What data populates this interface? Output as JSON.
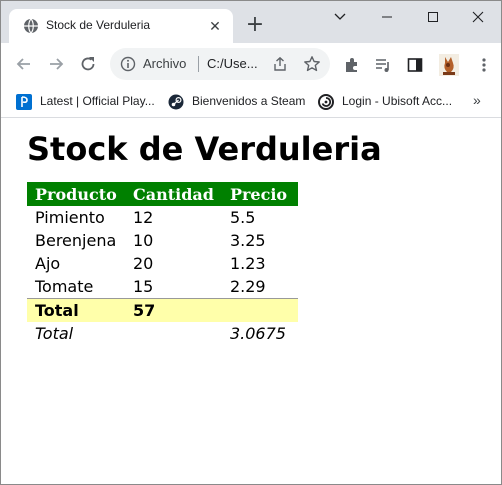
{
  "browser": {
    "tab_title": "Stock de Verduleria",
    "new_tab_symbol": "+",
    "address_label": "Archivo",
    "address_url": "C:/Use..."
  },
  "bookmarks": [
    {
      "label": "Latest | Official Play...",
      "icon": "playstation-icon"
    },
    {
      "label": "Bienvenidos a Steam",
      "icon": "steam-icon"
    },
    {
      "label": "Login - Ubisoft Acc...",
      "icon": "ubisoft-icon"
    }
  ],
  "bookmarks_more": "»",
  "page": {
    "heading": "Stock de Verduleria",
    "table": {
      "headers": [
        "Producto",
        "Cantidad",
        "Precio"
      ],
      "rows": [
        [
          "Pimiento",
          "12",
          "5.5"
        ],
        [
          "Berenjena",
          "10",
          "3.25"
        ],
        [
          "Ajo",
          "20",
          "1.23"
        ],
        [
          "Tomate",
          "15",
          "2.29"
        ]
      ],
      "total_row": [
        "Total",
        "57",
        ""
      ],
      "average_row": [
        "Total",
        "",
        "3.0675"
      ]
    }
  },
  "colors": {
    "header_bg": "#008000",
    "total_bg": "#ffffaa",
    "tabstrip_bg": "#dee1e6"
  }
}
